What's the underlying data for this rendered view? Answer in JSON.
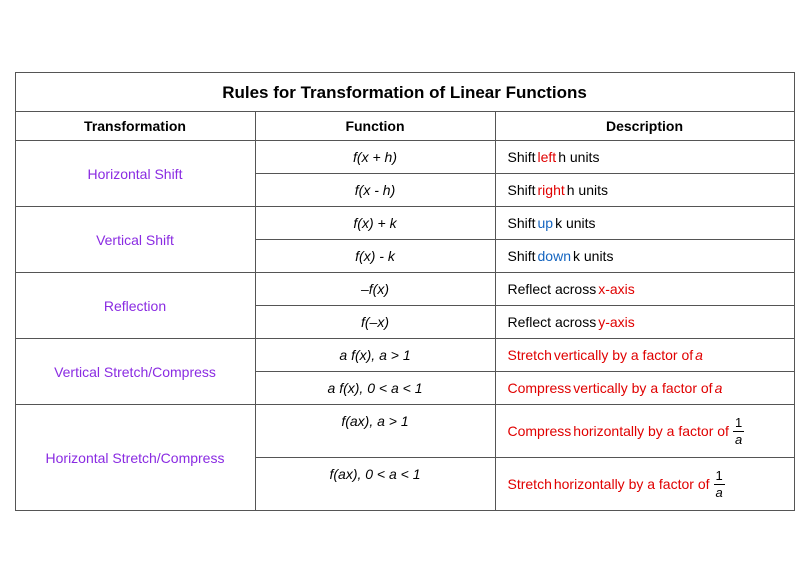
{
  "title": "Rules for Transformation of Linear Functions",
  "headers": [
    "Transformation",
    "Function",
    "Description"
  ],
  "groups": [
    {
      "label": "Horizontal Shift",
      "rows": [
        {
          "func": "f(x + h)",
          "desc_parts": [
            {
              "text": "Shift ",
              "color": ""
            },
            {
              "text": "left",
              "color": "red"
            },
            {
              "text": " h units",
              "color": ""
            }
          ]
        },
        {
          "func": "f(x  - h)",
          "desc_parts": [
            {
              "text": "Shift ",
              "color": ""
            },
            {
              "text": "right",
              "color": "red"
            },
            {
              "text": " h units",
              "color": ""
            }
          ]
        }
      ]
    },
    {
      "label": "Vertical Shift",
      "rows": [
        {
          "func": "f(x) + k",
          "desc_parts": [
            {
              "text": "Shift ",
              "color": ""
            },
            {
              "text": "up",
              "color": "blue"
            },
            {
              "text": " k units",
              "color": ""
            }
          ]
        },
        {
          "func": "f(x) - k",
          "desc_parts": [
            {
              "text": "Shift ",
              "color": ""
            },
            {
              "text": "down",
              "color": "blue"
            },
            {
              "text": " k units",
              "color": ""
            }
          ]
        }
      ]
    },
    {
      "label": "Reflection",
      "rows": [
        {
          "func": "–f(x)",
          "desc_parts": [
            {
              "text": "Reflect across ",
              "color": ""
            },
            {
              "text": "x-axis",
              "color": "red"
            }
          ]
        },
        {
          "func": "f(–x)",
          "desc_parts": [
            {
              "text": "Reflect across ",
              "color": ""
            },
            {
              "text": "y-axis",
              "color": "red"
            }
          ]
        }
      ]
    },
    {
      "label": "Vertical Stretch/Compress",
      "rows": [
        {
          "func": "a f(x), a > 1",
          "desc_parts": [
            {
              "text": "Stretch",
              "color": "red"
            },
            {
              "text": " vertically by a factor of ",
              "color": "red"
            },
            {
              "text": "a",
              "color": "red",
              "italic": true
            }
          ]
        },
        {
          "func": "a f(x), 0 < a < 1",
          "desc_parts": [
            {
              "text": "Compress",
              "color": "red"
            },
            {
              "text": " vertically by a factor of ",
              "color": "red"
            },
            {
              "text": "a",
              "color": "red",
              "italic": true
            }
          ]
        }
      ]
    },
    {
      "label": "Horizontal Stretch/Compress",
      "rows": [
        {
          "func": "f(ax), a > 1",
          "desc_type": "fraction",
          "desc_prefix_parts": [
            {
              "text": "Compress",
              "color": "red"
            },
            {
              "text": " horizontally by a factor of ",
              "color": "red"
            }
          ]
        },
        {
          "func": "f(ax), 0 < a < 1",
          "desc_type": "fraction",
          "desc_prefix_parts": [
            {
              "text": "Stretch",
              "color": "red"
            },
            {
              "text": " horizontally by a factor of ",
              "color": "red"
            }
          ]
        }
      ]
    }
  ]
}
